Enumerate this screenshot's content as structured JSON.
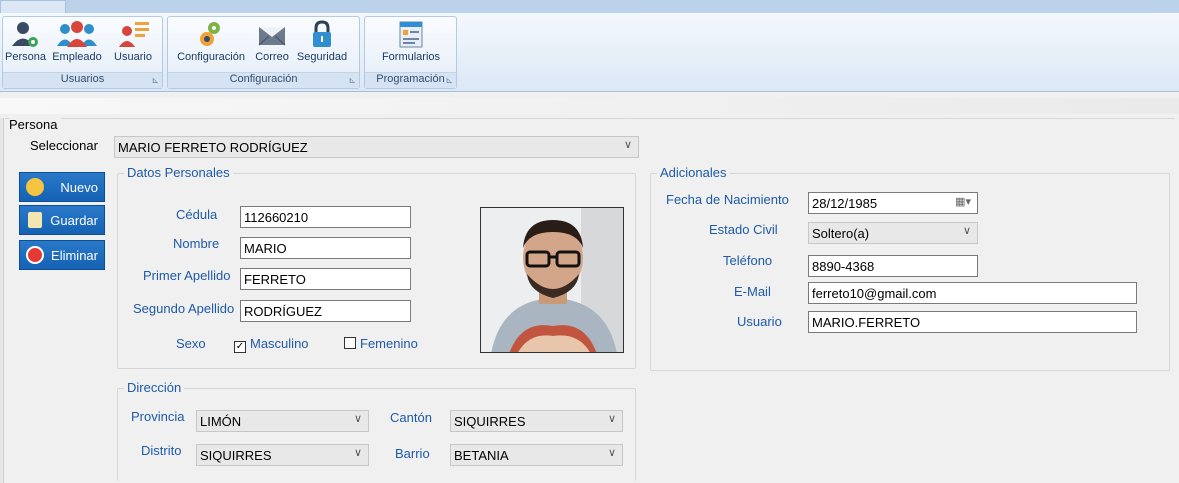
{
  "ribbon": {
    "groups": [
      {
        "title": "Usuarios",
        "buttons": [
          "Persona",
          "Empleado",
          "Usuario"
        ]
      },
      {
        "title": "Configuración",
        "buttons": [
          "Configuración",
          "Correo",
          "Seguridad"
        ]
      },
      {
        "title": "Programación",
        "buttons": [
          "Formularios"
        ]
      }
    ]
  },
  "persona": {
    "title": "Persona",
    "select_label": "Seleccionar",
    "selected_person": "MARIO FERRETO RODRÍGUEZ"
  },
  "actions": {
    "nuevo": "Nuevo",
    "guardar": "Guardar",
    "eliminar": "Eliminar"
  },
  "datos_personales": {
    "legend": "Datos Personales",
    "cedula_label": "Cédula",
    "cedula": "112660210",
    "nombre_label": "Nombre",
    "nombre": "MARIO",
    "primer_apellido_label": "Primer Apellido",
    "primer_apellido": "FERRETO",
    "segundo_apellido_label": "Segundo Apellido",
    "segundo_apellido": "RODRÍGUEZ",
    "sexo_label": "Sexo",
    "masculino_label": "Masculino",
    "masculino_checked": true,
    "femenino_label": "Femenino",
    "femenino_checked": false,
    "checkmark": "✓"
  },
  "adicionales": {
    "legend": "Adicionales",
    "fecha_label": "Fecha de Nacimiento",
    "fecha": "28/12/1985",
    "estado_civil_label": "Estado Civil",
    "estado_civil": "Soltero(a)",
    "telefono_label": "Teléfono",
    "telefono": "8890-4368",
    "email_label": "E-Mail",
    "email": "ferreto10@gmail.com",
    "usuario_label": "Usuario",
    "usuario": "MARIO.FERRETO"
  },
  "direccion": {
    "legend": "Dirección",
    "provincia_label": "Provincia",
    "provincia": "LIMÓN",
    "canton_label": "Cantón",
    "canton": "SIQUIRRES",
    "distrito_label": "Distrito",
    "distrito": "SIQUIRRES",
    "barrio_label": "Barrio",
    "barrio": "BETANIA"
  },
  "icons": {
    "dropdown": "chevron-down-icon",
    "calendar": "calendar-icon"
  },
  "colors": {
    "accent": "#1e5aa8",
    "button": "#1a68b9"
  }
}
